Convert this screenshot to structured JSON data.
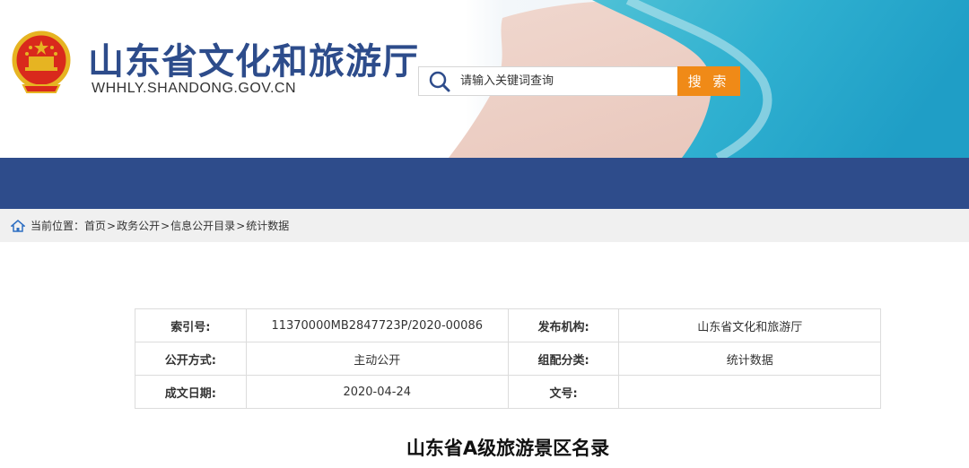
{
  "header": {
    "title": "山东省文化和旅游厅",
    "domain": "WHHLY.SHANDONG.GOV.CN",
    "icons": {
      "emblem": "national-emblem-icon",
      "search": "magnifier-icon"
    }
  },
  "search": {
    "placeholder": "请输入关键词查询",
    "button_label": "搜 索"
  },
  "breadcrumb": {
    "label": "当前位置：",
    "items": [
      "首页",
      "政务公开",
      "信息公开目录",
      "统计数据"
    ],
    "separator": ">"
  },
  "info": {
    "rows": [
      {
        "k1": "索引号:",
        "v1": "11370000MB2847723P/2020-00086",
        "k2": "发布机构:",
        "v2": "山东省文化和旅游厅"
      },
      {
        "k1": "公开方式:",
        "v1": "主动公开",
        "k2": "组配分类:",
        "v2": "统计数据"
      },
      {
        "k1": "成文日期:",
        "v1": "2020-04-24",
        "k2": "文号:",
        "v2": ""
      }
    ]
  },
  "article": {
    "title": "山东省A级旅游景区名录"
  },
  "colors": {
    "brand_blue": "#2e4c8b",
    "search_orange": "#f08a17",
    "title_blue": "#2d4c8b"
  }
}
